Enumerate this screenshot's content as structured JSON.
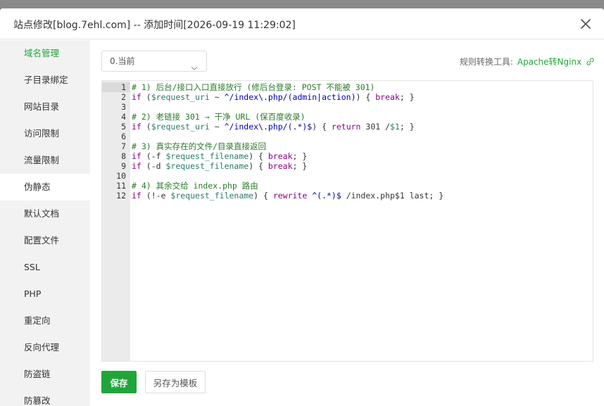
{
  "dialog": {
    "title": "站点修改[blog.7ehl.com] -- 添加时间[2026-09-19 11:29:02]"
  },
  "sidebar": {
    "items": [
      {
        "label": "域名管理"
      },
      {
        "label": "子目录绑定"
      },
      {
        "label": "网站目录"
      },
      {
        "label": "访问限制"
      },
      {
        "label": "流量限制"
      },
      {
        "label": "伪静态"
      },
      {
        "label": "默认文档"
      },
      {
        "label": "配置文件"
      },
      {
        "label": "SSL"
      },
      {
        "label": "PHP"
      },
      {
        "label": "重定向"
      },
      {
        "label": "反向代理"
      },
      {
        "label": "防盗链"
      },
      {
        "label": "防篡改"
      }
    ],
    "highlighted": "域名管理",
    "selected": "伪静态"
  },
  "rewrite": {
    "select_value": "0.当前",
    "tool_label": "规则转换工具:",
    "tool_link": "Apache转Nginx"
  },
  "editor": {
    "lines": [
      {
        "n": "1",
        "parts": [
          [
            "c-com",
            "# 1) 后台/接口入口直接放行 (修后台登录: POST 不能被 301)"
          ]
        ]
      },
      {
        "n": "2",
        "parts": [
          [
            "c-kw",
            "if"
          ],
          [
            "c-plain",
            " ("
          ],
          [
            "c-var",
            "$request_uri"
          ],
          [
            "c-plain",
            " ~ "
          ],
          [
            "c-str",
            "^/index\\.php/(admin|action)"
          ],
          [
            "c-plain",
            ") { "
          ],
          [
            "c-kw",
            "break"
          ],
          [
            "c-plain",
            "; }"
          ]
        ]
      },
      {
        "n": "3",
        "parts": []
      },
      {
        "n": "4",
        "parts": [
          [
            "c-com",
            "# 2) 老链接 301 → 干净 URL (保百度收录)"
          ]
        ]
      },
      {
        "n": "5",
        "parts": [
          [
            "c-kw",
            "if"
          ],
          [
            "c-plain",
            " ("
          ],
          [
            "c-var",
            "$request_uri"
          ],
          [
            "c-plain",
            " ~ "
          ],
          [
            "c-str",
            "^/index\\.php/(.*)$"
          ],
          [
            "c-plain",
            ") { "
          ],
          [
            "c-kw",
            "return"
          ],
          [
            "c-plain",
            " 301 /"
          ],
          [
            "c-var",
            "$1"
          ],
          [
            "c-plain",
            "; }"
          ]
        ]
      },
      {
        "n": "6",
        "parts": []
      },
      {
        "n": "7",
        "parts": [
          [
            "c-com",
            "# 3) 真实存在的文件/目录直接返回"
          ]
        ]
      },
      {
        "n": "8",
        "parts": [
          [
            "c-kw",
            "if"
          ],
          [
            "c-plain",
            " (-f "
          ],
          [
            "c-var",
            "$request_filename"
          ],
          [
            "c-plain",
            ") { "
          ],
          [
            "c-kw",
            "break"
          ],
          [
            "c-plain",
            "; }"
          ]
        ]
      },
      {
        "n": "9",
        "parts": [
          [
            "c-kw",
            "if"
          ],
          [
            "c-plain",
            " (-d "
          ],
          [
            "c-var",
            "$request_filename"
          ],
          [
            "c-plain",
            ") { "
          ],
          [
            "c-kw",
            "break"
          ],
          [
            "c-plain",
            "; }"
          ]
        ]
      },
      {
        "n": "10",
        "parts": []
      },
      {
        "n": "11",
        "parts": [
          [
            "c-com",
            "# 4) 其余交给 index.php 路由"
          ]
        ]
      },
      {
        "n": "12",
        "parts": [
          [
            "c-kw",
            "if"
          ],
          [
            "c-plain",
            " (!-e "
          ],
          [
            "c-var",
            "$request_filename"
          ],
          [
            "c-plain",
            ") { "
          ],
          [
            "c-kw",
            "rewrite"
          ],
          [
            "c-plain",
            " "
          ],
          [
            "c-str",
            "^(.*)$"
          ],
          [
            "c-plain",
            " /index.php$1 last; }"
          ]
        ]
      }
    ]
  },
  "buttons": {
    "save": "保存",
    "save_template": "另存为模板"
  },
  "colors": {
    "accent": "#20a53a"
  }
}
